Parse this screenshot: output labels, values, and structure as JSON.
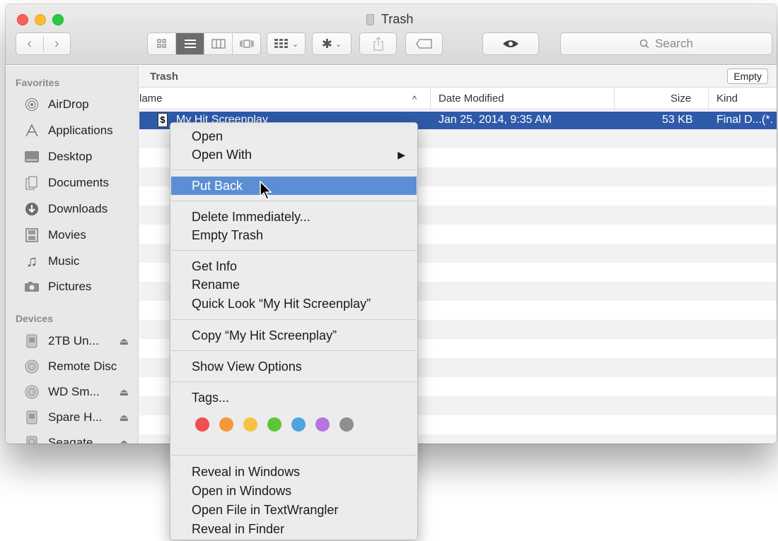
{
  "window": {
    "title": "Trash"
  },
  "search": {
    "placeholder": "Search"
  },
  "sidebar": {
    "favorites_heading": "Favorites",
    "favorites": [
      {
        "label": "AirDrop",
        "icon": "airdrop-icon"
      },
      {
        "label": "Applications",
        "icon": "applications-icon"
      },
      {
        "label": "Desktop",
        "icon": "desktop-icon"
      },
      {
        "label": "Documents",
        "icon": "documents-icon"
      },
      {
        "label": "Downloads",
        "icon": "downloads-icon"
      },
      {
        "label": "Movies",
        "icon": "movies-icon"
      },
      {
        "label": "Music",
        "icon": "music-icon"
      },
      {
        "label": "Pictures",
        "icon": "pictures-icon"
      }
    ],
    "devices_heading": "Devices",
    "devices": [
      {
        "label": "2TB Un...",
        "icon": "hard-drive-icon",
        "eject": "⏏"
      },
      {
        "label": "Remote Disc",
        "icon": "disc-icon"
      },
      {
        "label": "WD Sm...",
        "icon": "disc-icon",
        "eject": "⏏"
      },
      {
        "label": "Spare H...",
        "icon": "hard-drive-icon",
        "eject": "⏏"
      },
      {
        "label": "Seagate...",
        "icon": "hard-drive-icon",
        "eject": "⏏"
      }
    ]
  },
  "content": {
    "location": "Trash",
    "empty_button": "Empty",
    "columns": {
      "name": "lame",
      "sort_indicator": "^",
      "date": "Date Modified",
      "size": "Size",
      "kind": "Kind"
    },
    "selected_file": {
      "name": "My Hit Screenplay",
      "date": "Jan 25, 2014, 9:35 AM",
      "size": "53 KB",
      "kind": "Final D...(*."
    }
  },
  "context_menu": {
    "open": "Open",
    "open_with": "Open With",
    "put_back": "Put Back",
    "delete_immediately": "Delete Immediately...",
    "empty_trash": "Empty Trash",
    "get_info": "Get Info",
    "rename": "Rename",
    "quick_look": "Quick Look “My Hit Screenplay”",
    "copy": "Copy “My Hit Screenplay”",
    "show_view_options": "Show View Options",
    "tags": "Tags...",
    "tag_colors": [
      "#f0504f",
      "#f7953a",
      "#f5c342",
      "#5ec539",
      "#4fa3e0",
      "#b674dc",
      "#8e8e8e"
    ],
    "reveal_in_windows": "Reveal in Windows",
    "open_in_windows": "Open in Windows",
    "open_file_in_textwrangler": "Open File in TextWrangler",
    "reveal_in_finder": "Reveal in Finder"
  }
}
